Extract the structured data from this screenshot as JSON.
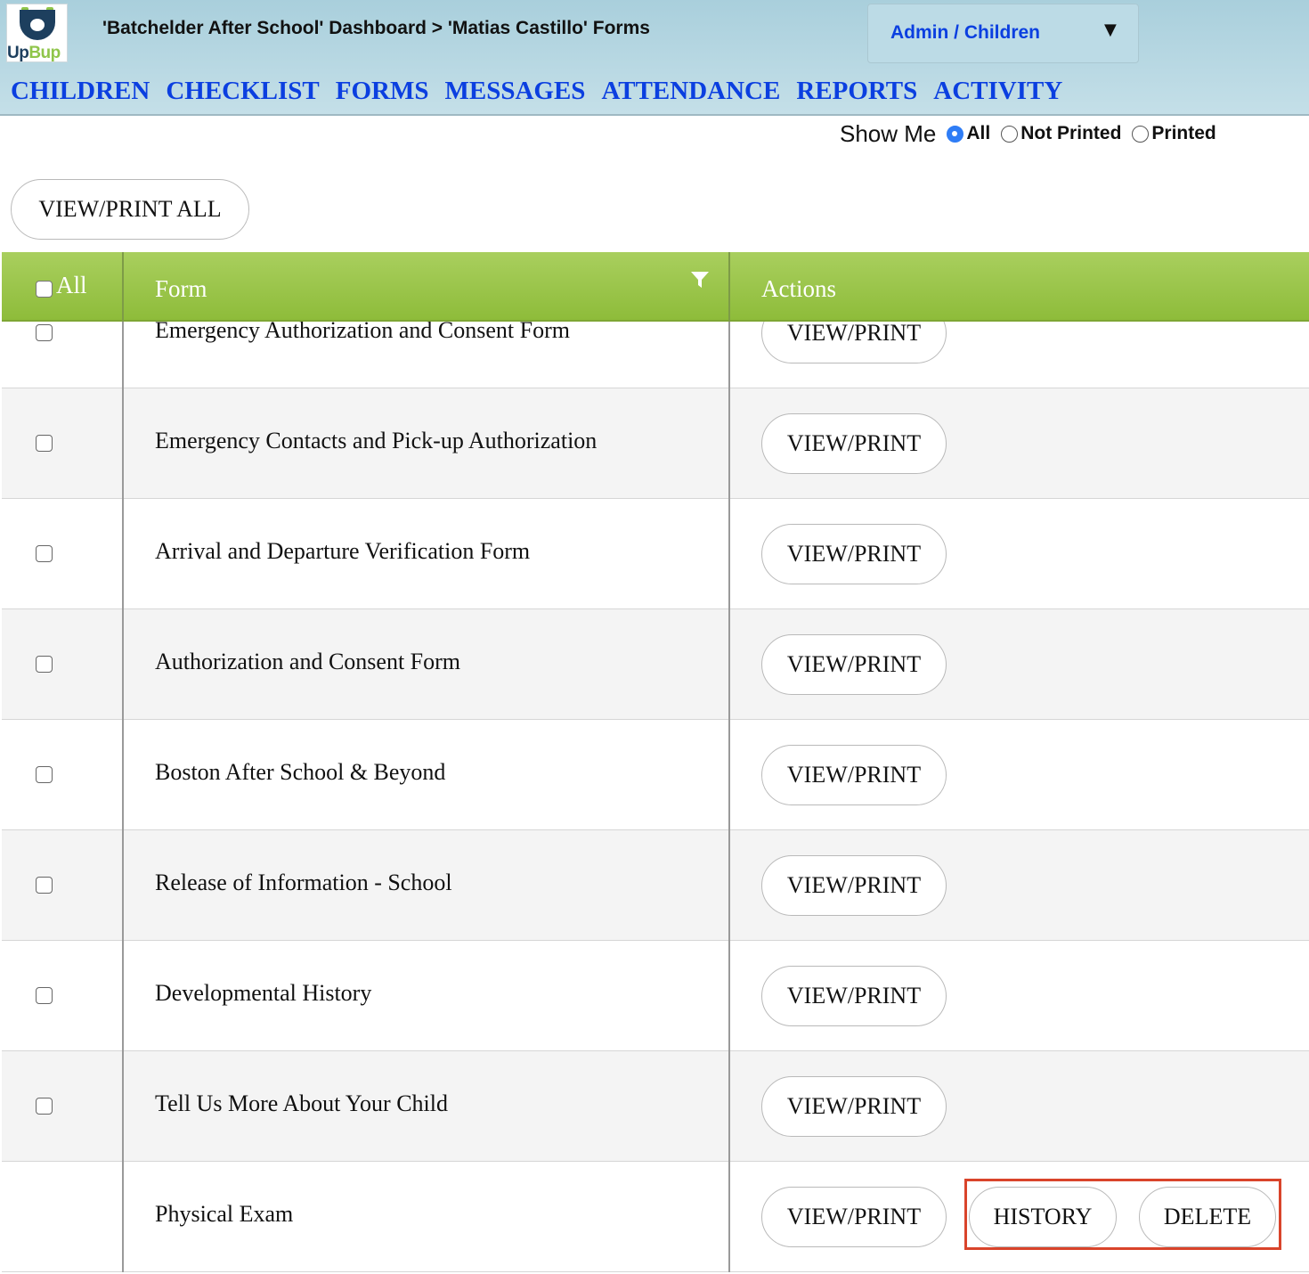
{
  "header": {
    "logo_text_a": "Up",
    "logo_text_b": "Bup",
    "breadcrumb": "'Batchelder After School' Dashboard > 'Matias Castillo' Forms",
    "role_select": "Admin / Children",
    "role_caret_icon": "caret-down-icon"
  },
  "nav": {
    "items": [
      "CHILDREN",
      "CHECKLIST",
      "FORMS",
      "MESSAGES",
      "ATTENDANCE",
      "REPORTS",
      "ACTIVITY"
    ]
  },
  "filter": {
    "label": "Show Me",
    "options": [
      "All",
      "Not Printed",
      "Printed"
    ],
    "selected": "All"
  },
  "toolbar": {
    "view_print_all": "VIEW/PRINT ALL"
  },
  "table": {
    "headers": {
      "select_all": "All",
      "form": "Form",
      "actions": "Actions"
    },
    "filter_icon": "filter-funnel-icon",
    "rows": [
      {
        "form": "Emergency Authorization and Consent Form",
        "action": "VIEW/PRINT"
      },
      {
        "form": "Emergency Contacts and Pick-up Authorization",
        "action": "VIEW/PRINT"
      },
      {
        "form": "Arrival and Departure Verification Form",
        "action": "VIEW/PRINT"
      },
      {
        "form": "Authorization and Consent Form",
        "action": "VIEW/PRINT"
      },
      {
        "form": "Boston After School & Beyond",
        "action": "VIEW/PRINT"
      },
      {
        "form": "Release of Information - School",
        "action": "VIEW/PRINT"
      },
      {
        "form": "Developmental History",
        "action": "VIEW/PRINT"
      },
      {
        "form": "Tell Us More About Your Child",
        "action": "VIEW/PRINT"
      },
      {
        "form": "Physical Exam",
        "action": "VIEW/PRINT",
        "history": "HISTORY",
        "delete": "DELETE"
      }
    ]
  },
  "colors": {
    "header_bg": "#b9d9e4",
    "nav_link": "#0b3fe0",
    "table_header": "#9cc64b",
    "highlight_border": "#d9442b",
    "radio_selected": "#2f7df6"
  }
}
